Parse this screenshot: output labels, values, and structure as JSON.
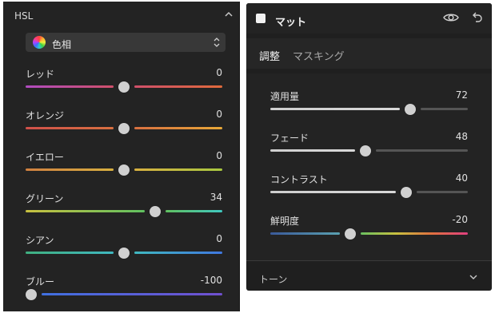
{
  "hsl_panel": {
    "title": "HSL",
    "mode_select": {
      "value": "色相"
    },
    "sliders": [
      {
        "label": "レッド",
        "value": "0",
        "fraction": 0.5,
        "left_color": "#b04cc0",
        "mid_color": "#d0506a",
        "right_color": "#e06a3c"
      },
      {
        "label": "オレンジ",
        "value": "0",
        "fraction": 0.5,
        "left_color": "#d0504a",
        "mid_color": "#d87040",
        "right_color": "#e8a838"
      },
      {
        "label": "イエロー",
        "value": "0",
        "fraction": 0.5,
        "left_color": "#d08040",
        "mid_color": "#d8b040",
        "right_color": "#a8c840"
      },
      {
        "label": "グリーン",
        "value": "34",
        "fraction": 0.67,
        "left_color": "#c8c040",
        "mid_color": "#60c060",
        "right_color": "#40c8c0"
      },
      {
        "label": "シアン",
        "value": "0",
        "fraction": 0.5,
        "left_color": "#40b080",
        "mid_color": "#40b8c0",
        "right_color": "#4078e0"
      },
      {
        "label": "ブルー",
        "value": "-100",
        "fraction": 0.0,
        "left_color": "#30b8c8",
        "mid_color": "#4070e0",
        "right_color": "#7050d0"
      }
    ]
  },
  "matte_panel": {
    "title": "マット",
    "tabs": [
      {
        "label": "調整",
        "active": true
      },
      {
        "label": "マスキング",
        "active": false
      }
    ],
    "sliders": [
      {
        "label": "適用量",
        "value": "72",
        "fraction": 0.72,
        "style": "gray"
      },
      {
        "label": "フェード",
        "value": "48",
        "fraction": 0.48,
        "style": "gray"
      },
      {
        "label": "コントラスト",
        "value": "40",
        "fraction": 0.7,
        "style": "gray"
      },
      {
        "label": "鮮明度",
        "value": "-20",
        "fraction": 0.4,
        "style": "color"
      }
    ],
    "section": {
      "label": "トーン"
    }
  }
}
